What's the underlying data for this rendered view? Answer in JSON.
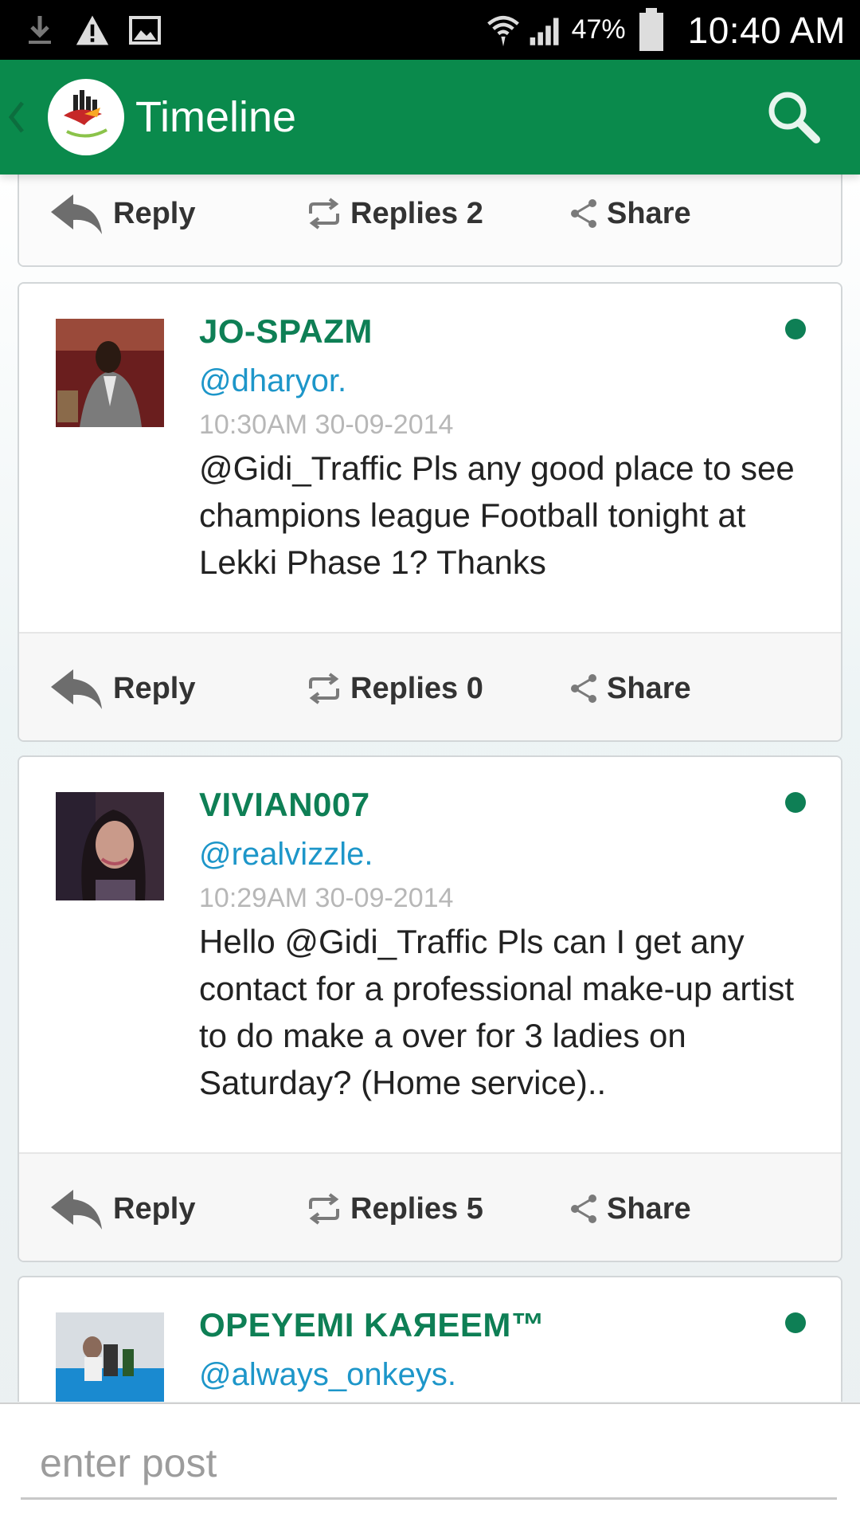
{
  "status_bar": {
    "battery_percent": "47%",
    "time": "10:40 AM",
    "icons": [
      "download-icon",
      "warning-icon",
      "image-icon",
      "wifi-icon",
      "signal-icon",
      "battery-icon"
    ]
  },
  "app_bar": {
    "title": "Timeline",
    "back_icon": "chevron-left-icon",
    "search_icon": "search-icon",
    "accent": "#0a8a4c"
  },
  "action_labels": {
    "reply": "Reply",
    "share": "Share"
  },
  "top_card": {
    "replies_label": "Replies 2"
  },
  "posts": [
    {
      "username": "JO-SPAZM",
      "handle": "@dharyor.",
      "timestamp": "10:30AM 30-09-2014",
      "message": "@Gidi_Traffic Pls any good place to see champions league Football tonight at Lekki Phase 1? Thanks",
      "replies_label": "Replies 0"
    },
    {
      "username": "VIVIAN007",
      "handle": "@realvizzle.",
      "timestamp": "10:29AM 30-09-2014",
      "message": "Hello @Gidi_Traffic Pls can I get any contact for a professional make-up artist to do make a over for 3 ladies on Saturday? (Home service)..",
      "replies_label": "Replies 5"
    },
    {
      "username": "OPEYEMI KAЯEEM™",
      "handle": "@always_onkeys."
    }
  ],
  "compose": {
    "placeholder": "enter post"
  },
  "colors": {
    "username": "#0e7f55",
    "handle": "#1d96c9",
    "online": "#0e7f55"
  }
}
